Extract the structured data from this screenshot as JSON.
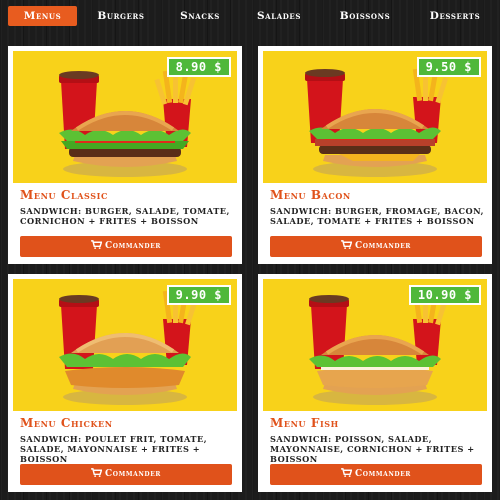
{
  "nav": {
    "items": [
      {
        "label": "Menus",
        "active": true
      },
      {
        "label": "Burgers",
        "active": false
      },
      {
        "label": "Snacks",
        "active": false
      },
      {
        "label": "Salades",
        "active": false
      },
      {
        "label": "Boissons",
        "active": false
      },
      {
        "label": "Desserts",
        "active": false
      }
    ]
  },
  "cards": [
    {
      "title": "Menu Classic",
      "price": "8.90 $",
      "description": "SANDWICH: BURGER, SALADE, TOMATE, CORNICHON + FRITES + BOISSON",
      "button": "Commander",
      "image": "burger-classic-image"
    },
    {
      "title": "Menu Bacon",
      "price": "9.50 $",
      "description": "SANDWICH: BURGER, FROMAGE, BACON, SALADE, TOMATE + FRITES + BOISSON",
      "button": "Commander",
      "image": "burger-bacon-image"
    },
    {
      "title": "Menu Chicken",
      "price": "9.90 $",
      "description": "SANDWICH: POULET FRIT, TOMATE, SALADE, MAYONNAISE + FRITES + BOISSON",
      "button": "Commander",
      "image": "burger-chicken-image"
    },
    {
      "title": "Menu Fish",
      "price": "10.90 $",
      "description": "SANDWICH: POISSON, SALADE, MAYONNAISE, CORNICHON + FRITES + BOISSON",
      "button": "Commander",
      "image": "burger-fish-image"
    }
  ],
  "colors": {
    "accent": "#e0521b",
    "price_badge": "#4fb83a",
    "image_bg": "#f8d21a",
    "page_bg": "#1c1c1c"
  },
  "icons": {
    "button": "shopping-cart-icon"
  }
}
